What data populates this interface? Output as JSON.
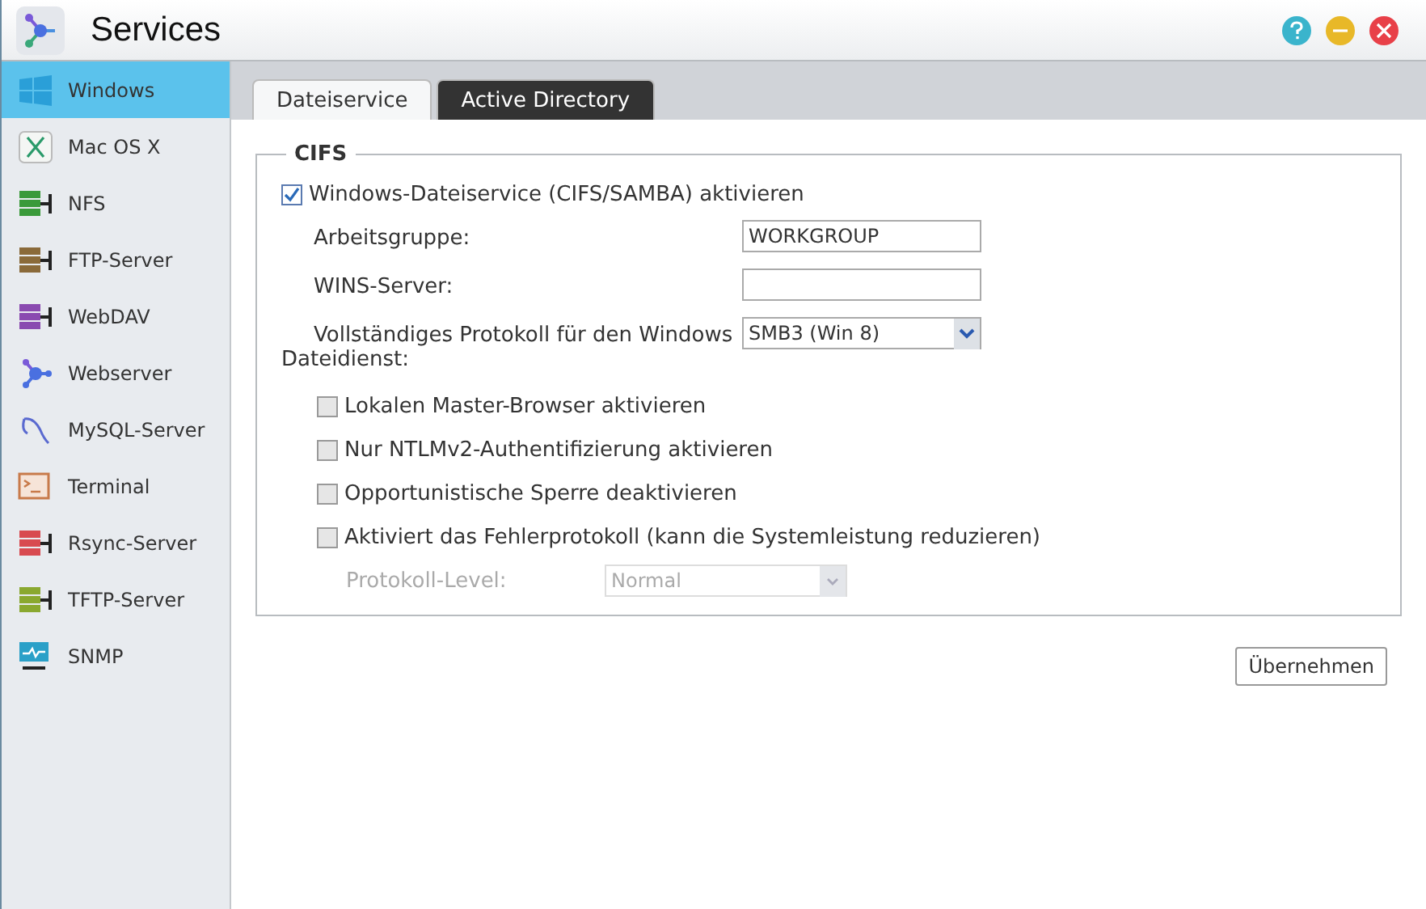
{
  "window": {
    "title": "Services"
  },
  "sidebar": {
    "items": [
      {
        "label": "Windows",
        "selected": true
      },
      {
        "label": "Mac OS X",
        "selected": false
      },
      {
        "label": "NFS",
        "selected": false
      },
      {
        "label": "FTP-Server",
        "selected": false
      },
      {
        "label": "WebDAV",
        "selected": false
      },
      {
        "label": "Webserver",
        "selected": false
      },
      {
        "label": "MySQL-Server",
        "selected": false
      },
      {
        "label": "Terminal",
        "selected": false
      },
      {
        "label": "Rsync-Server",
        "selected": false
      },
      {
        "label": "TFTP-Server",
        "selected": false
      },
      {
        "label": "SNMP",
        "selected": false
      }
    ]
  },
  "tabs": [
    {
      "label": "Dateiservice",
      "selected": true
    },
    {
      "label": "Active Directory",
      "selected": false
    }
  ],
  "cifs": {
    "legend": "CIFS",
    "enable": {
      "label": "Windows-Dateiservice (CIFS/SAMBA) aktivieren",
      "checked": true
    },
    "fields": [
      {
        "kind": "text",
        "label": "Arbeitsgruppe:",
        "value": "WORKGROUP"
      },
      {
        "kind": "text",
        "label": "WINS-Server:"
      },
      {
        "kind": "select",
        "label": "Vollständiges Protokoll für den Windows Dateidienst:",
        "value": "SMB3 (Win 8)"
      }
    ],
    "options": [
      {
        "label": "Lokalen Master-Browser aktivieren",
        "checked": false
      },
      {
        "label": "Nur NTLMv2-Authentifizierung aktivieren",
        "checked": false
      },
      {
        "label": "Opportunistische Sperre deaktivieren",
        "checked": false
      },
      {
        "label": "Aktiviert das Fehlerprotokoll (kann die Systemleistung reduzieren)",
        "checked": false
      }
    ],
    "log_level": {
      "label": "Protokoll-Level:",
      "value": "Normal",
      "disabled": true
    }
  },
  "buttons": [
    "Übernehmen"
  ]
}
